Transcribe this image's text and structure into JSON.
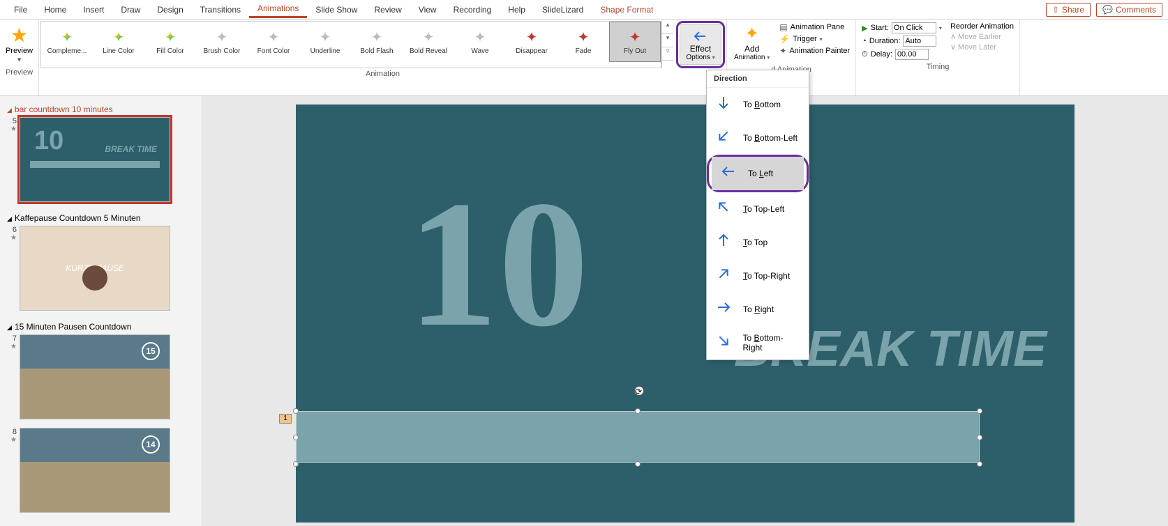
{
  "tabs": {
    "file": "File",
    "home": "Home",
    "insert": "Insert",
    "draw": "Draw",
    "design": "Design",
    "transitions": "Transitions",
    "animations": "Animations",
    "slideshow": "Slide Show",
    "review": "Review",
    "view": "View",
    "recording": "Recording",
    "help": "Help",
    "slidelizard": "SlideLizard",
    "shapeformat": "Shape Format"
  },
  "topright": {
    "share": "Share",
    "comments": "Comments"
  },
  "preview": {
    "label": "Preview",
    "group": "Preview"
  },
  "gallery": {
    "items": [
      {
        "label": "Compleme...",
        "icon": "star-rainbow"
      },
      {
        "label": "Line Color",
        "icon": "star-rainbow"
      },
      {
        "label": "Fill Color",
        "icon": "star-rainbow"
      },
      {
        "label": "Brush Color",
        "icon": "star-gray"
      },
      {
        "label": "Font Color",
        "icon": "star-gray"
      },
      {
        "label": "Underline",
        "icon": "star-gray"
      },
      {
        "label": "Bold Flash",
        "icon": "star-gray"
      },
      {
        "label": "Bold Reveal",
        "icon": "star-gray"
      },
      {
        "label": "Wave",
        "icon": "star-gray"
      },
      {
        "label": "Disappear",
        "icon": "star-red"
      },
      {
        "label": "Fade",
        "icon": "star-red"
      },
      {
        "label": "Fly Out",
        "icon": "star-red"
      }
    ],
    "group": "Animation"
  },
  "effect_options": {
    "line1": "Effect",
    "line2": "Options"
  },
  "add_anim": {
    "line1": "Add",
    "line2": "Animation"
  },
  "advanced": {
    "pane": "Animation Pane",
    "trigger": "Trigger",
    "painter": "Animation Painter",
    "group": "d Animation"
  },
  "timing": {
    "start_label": "Start:",
    "start_value": "On Click",
    "duration_label": "Duration:",
    "duration_value": "Auto",
    "delay_label": "Delay:",
    "delay_value": "00.00",
    "group": "Timing"
  },
  "reorder": {
    "title": "Reorder Animation",
    "earlier": "Move Earlier",
    "later": "Move Later"
  },
  "dropdown": {
    "header": "Direction",
    "items": [
      {
        "label": "To Bottom",
        "accel": "B",
        "rot": 90
      },
      {
        "label": "To Bottom-Left",
        "accel": "B",
        "rot": 135
      },
      {
        "label": "To Left",
        "accel": "L",
        "rot": 180,
        "selected": true
      },
      {
        "label": "To Top-Left",
        "accel": "T",
        "rot": 225
      },
      {
        "label": "To Top",
        "accel": "T",
        "rot": 270
      },
      {
        "label": "To Top-Right",
        "accel": "T",
        "rot": 315
      },
      {
        "label": "To Right",
        "accel": "R",
        "rot": 0
      },
      {
        "label": "To Bottom-Right",
        "accel": "B",
        "rot": 45
      }
    ]
  },
  "sidebar": {
    "sections": [
      {
        "title": "bar countdown 10 minutes",
        "red": true,
        "slides": [
          {
            "num": "5",
            "kind": "teal",
            "big": "10",
            "small": "BREAK TIME",
            "selected": true
          }
        ]
      },
      {
        "title": "Kaffepause Countdown 5 Minuten",
        "slides": [
          {
            "num": "6",
            "kind": "beige",
            "pause": "KURZE PAUSE"
          }
        ]
      },
      {
        "title": "15 Minuten Pausen Countdown",
        "slides": [
          {
            "num": "7",
            "kind": "photo",
            "circle": "15"
          },
          {
            "num": "8",
            "kind": "photo",
            "circle": "14"
          }
        ]
      }
    ]
  },
  "slide": {
    "big": "10",
    "break": "BREAK TIME",
    "tag": "1"
  }
}
